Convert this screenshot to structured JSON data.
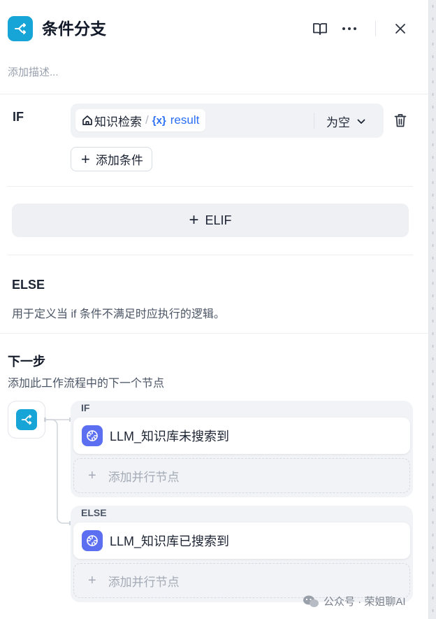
{
  "header": {
    "title": "条件分支",
    "description_placeholder": "添加描述..."
  },
  "if_case": {
    "label": "IF",
    "condition": {
      "source_node": "知识检索",
      "separator": "/",
      "variable_symbol": "{x}",
      "variable": "result",
      "operator": "为空"
    },
    "add_condition_label": "添加条件"
  },
  "elif": {
    "label": "ELIF"
  },
  "else_case": {
    "label": "ELSE",
    "description": "用于定义当 if 条件不满足时应执行的逻辑。"
  },
  "next_step": {
    "title": "下一步",
    "description": "添加此工作流程中的下一个节点",
    "branches": [
      {
        "label": "IF",
        "target": "LLM_知识库未搜索到",
        "add_parallel": "添加并行节点"
      },
      {
        "label": "ELSE",
        "target": "LLM_知识库已搜索到",
        "add_parallel": "添加并行节点"
      }
    ]
  },
  "watermark": "公众号 · 荣姐聊AI",
  "colors": {
    "node_accent": "#17a5d8",
    "variable_blue": "#2b6ff5",
    "llm_icon": "#5b6ff0"
  },
  "icons": [
    "branch-icon",
    "book-icon",
    "more-icon",
    "close-icon",
    "home-icon",
    "chevron-down-icon",
    "trash-icon",
    "plus-icon",
    "llm-icon",
    "wechat-icon"
  ]
}
